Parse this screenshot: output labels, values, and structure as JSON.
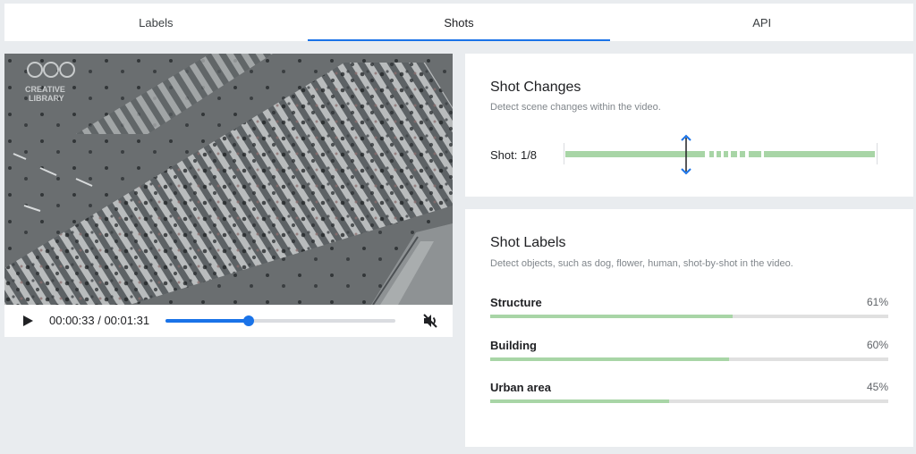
{
  "tabs": [
    {
      "label": "Labels",
      "active": false
    },
    {
      "label": "Shots",
      "active": true
    },
    {
      "label": "API",
      "active": false
    }
  ],
  "player": {
    "time": "00:00:33 / 00:01:31",
    "progress": 0.36,
    "muted": true,
    "watermark_lines": [
      "CREATIVE",
      "LIBRARY"
    ],
    "icons": {
      "play": "play-icon",
      "mute": "volume-off-icon"
    }
  },
  "shot_changes": {
    "title": "Shot Changes",
    "description": "Detect scene changes within the video.",
    "shot_label": "Shot: 1/8",
    "current_shot": 1,
    "total_shots": 8
  },
  "shot_labels": {
    "title": "Shot Labels",
    "description": "Detect objects, such as dog, flower, human, shot-by-shot in the video.",
    "items": [
      {
        "name": "Structure",
        "percent": "61%",
        "value": 0.61
      },
      {
        "name": "Building",
        "percent": "60%",
        "value": 0.6
      },
      {
        "name": "Urban area",
        "percent": "45%",
        "value": 0.45
      }
    ]
  },
  "colors": {
    "accent": "#1a73e8",
    "bar_green": "#a8d5a6"
  }
}
